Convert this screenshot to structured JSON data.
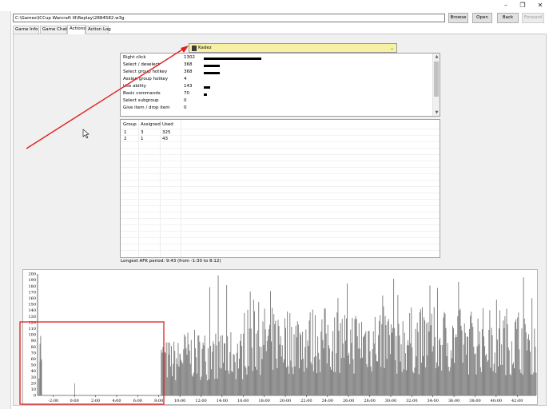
{
  "window": {
    "minimize": "–",
    "restore": "❐",
    "close": "✕"
  },
  "toolbar": {
    "path_value": "C:\\Games\\ICCup Warcraft III\\Replay\\2884582.w3g",
    "browse": "Browse",
    "open": "Open",
    "back": "Back",
    "forward": "Forward"
  },
  "tabs": [
    {
      "label": "Game Info",
      "active": false
    },
    {
      "label": "Game Chat",
      "active": false
    },
    {
      "label": "Actions",
      "active": true
    },
    {
      "label": "Action Log",
      "active": false
    }
  ],
  "player": {
    "selected": "Kadez",
    "icon": "player-race-icon"
  },
  "actions": [
    {
      "label": "Right click",
      "value": "1302"
    },
    {
      "label": "Select / deselect",
      "value": "368"
    },
    {
      "label": "Select group hotkey",
      "value": "368"
    },
    {
      "label": "Assign group hotkey",
      "value": "4"
    },
    {
      "label": "Use ability",
      "value": "143"
    },
    {
      "label": "Basic commands",
      "value": "70"
    },
    {
      "label": "Select subgroup",
      "value": "0"
    },
    {
      "label": "Give item / drop item",
      "value": "0"
    }
  ],
  "groups": {
    "headers": [
      "Group",
      "Assigned",
      "Used"
    ],
    "rows": [
      [
        "1",
        "3",
        "325"
      ],
      [
        "2",
        "1",
        "43"
      ]
    ]
  },
  "afk": "Longest AFK period: 9:43 (from -1:30 to 8:12)",
  "chart_data": {
    "type": "bar",
    "title": "",
    "xlabel": "",
    "ylabel": "",
    "ylim": [
      0,
      200
    ],
    "yticks": [
      "0",
      "10",
      "20",
      "30",
      "40",
      "50",
      "60",
      "70",
      "80",
      "90",
      "100",
      "110",
      "120",
      "130",
      "140",
      "150",
      "160",
      "170",
      "180",
      "190",
      "200"
    ],
    "xticks": [
      "-2:00",
      "0:00",
      "2:00",
      "4:00",
      "6:00",
      "8:00",
      "10:00",
      "12:00",
      "14:00",
      "16:00",
      "18:00",
      "20:00",
      "22:00",
      "24:00",
      "26:00",
      "28:00",
      "30:00",
      "32:00",
      "34:00",
      "36:00",
      "38:00",
      "40:00",
      "42:00"
    ],
    "x_range_minutes": [
      -3.5,
      43.8
    ],
    "bar_color": "#7f7f7f",
    "segment_averages": [
      {
        "from": -3.4,
        "to": -3.1,
        "avg": 80
      },
      {
        "from": -3.1,
        "to": 8.2,
        "avg": 0
      },
      {
        "from": 8.2,
        "to": 10.0,
        "avg": 60
      },
      {
        "from": 10.0,
        "to": 16.0,
        "avg": 70
      },
      {
        "from": 16.0,
        "to": 43.8,
        "avg": 95
      }
    ],
    "isolated_bars": [
      {
        "x": -3.3,
        "value": 85
      },
      {
        "x": -3.2,
        "value": 55
      },
      {
        "x": 0.0,
        "value": 20
      }
    ],
    "peak_value": 200
  }
}
